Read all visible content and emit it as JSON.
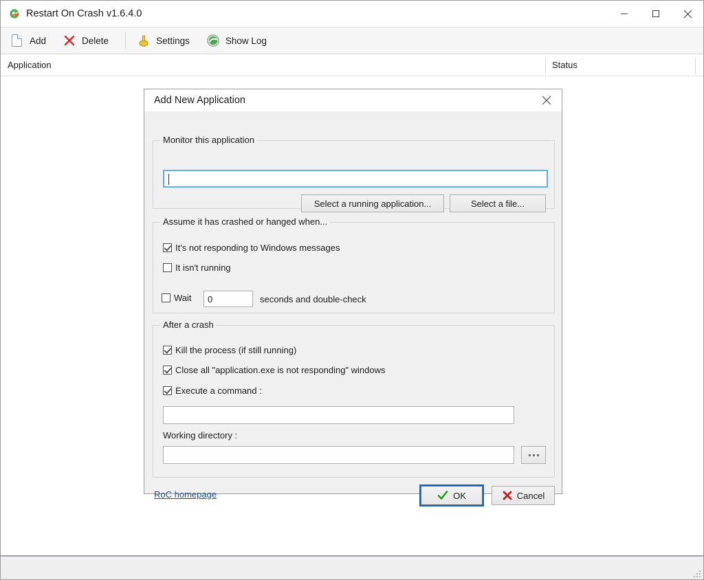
{
  "window": {
    "title": "Restart On Crash v1.6.4.0",
    "app_icon": "restart-on-crash-icon",
    "controls": {
      "minimize": "minimize-icon",
      "maximize": "maximize-icon",
      "close": "close-icon"
    }
  },
  "toolbar": {
    "items": [
      {
        "label": "Add",
        "icon": "new-document-icon"
      },
      {
        "label": "Delete",
        "icon": "red-x-icon"
      },
      {
        "label": "Settings",
        "icon": "settings-gear-icon"
      },
      {
        "label": "Show Log",
        "icon": "log-globe-icon"
      }
    ]
  },
  "list": {
    "columns": [
      "Application",
      "Status"
    ],
    "rows": []
  },
  "dialog": {
    "title": "Add New Application",
    "close_icon": "close-icon",
    "monitor_group": {
      "legend": "Monitor this application",
      "path_value": "",
      "path_placeholder": "",
      "select_running_label": "Select a running application...",
      "select_file_label": "Select a file..."
    },
    "assume_group": {
      "legend": "Assume it has crashed or hanged when...",
      "checkboxes": [
        {
          "label": "It's not responding to Windows messages",
          "checked": true
        },
        {
          "label": "It isn't running",
          "checked": false
        },
        {
          "label": "Wait",
          "checked": false
        }
      ],
      "wait_value": "0",
      "wait_suffix": "seconds and double-check"
    },
    "after_group": {
      "legend": "After a crash",
      "checkboxes": [
        {
          "label": "Kill the process (if still running)",
          "checked": true
        },
        {
          "label": "Close all \"application.exe is not responding\" windows",
          "checked": true
        },
        {
          "label": "Execute a command :",
          "checked": true
        }
      ],
      "command_value": "",
      "workdir_label": "Working directory :",
      "workdir_value": "",
      "browse_label": "..."
    },
    "footer": {
      "homepage_link": "RoC homepage",
      "ok_label": "OK",
      "cancel_label": "Cancel",
      "ok_icon": "green-check-icon",
      "cancel_icon": "red-x-icon"
    }
  },
  "colors": {
    "focus_blue": "#5daeea",
    "ok_outline": "#1565c0",
    "ok_check_green": "#2aa02a",
    "cancel_x_red": "#c62828",
    "link_blue": "#1a4fa0",
    "dialog_bg": "#f0f0f0",
    "toolbar_bg": "#f6f6f6"
  }
}
